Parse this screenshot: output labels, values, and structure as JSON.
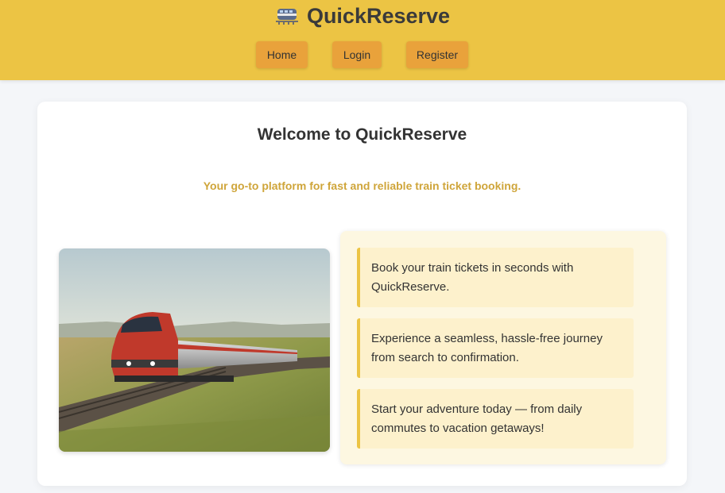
{
  "header": {
    "brand_icon": "train-icon",
    "brand_name": "QuickReserve",
    "nav": [
      {
        "label": "Home"
      },
      {
        "label": "Login"
      },
      {
        "label": "Register"
      }
    ]
  },
  "main": {
    "title": "Welcome to QuickReserve",
    "tagline": "Your go-to platform for fast and reliable train ticket booking.",
    "features": [
      {
        "text": "Book your train tickets in seconds with QuickReserve."
      },
      {
        "text": "Experience a seamless, hassle-free journey from search to confirmation."
      },
      {
        "text": "Start your adventure today — from daily commutes to vacation getaways!"
      }
    ]
  },
  "colors": {
    "header_bg": "#ecc444",
    "nav_button_bg": "#e9a23b",
    "tagline": "#cfa53a",
    "feature_bg": "#fdf1cc",
    "feature_border": "#ecc444",
    "page_bg": "#f4f6f9"
  }
}
